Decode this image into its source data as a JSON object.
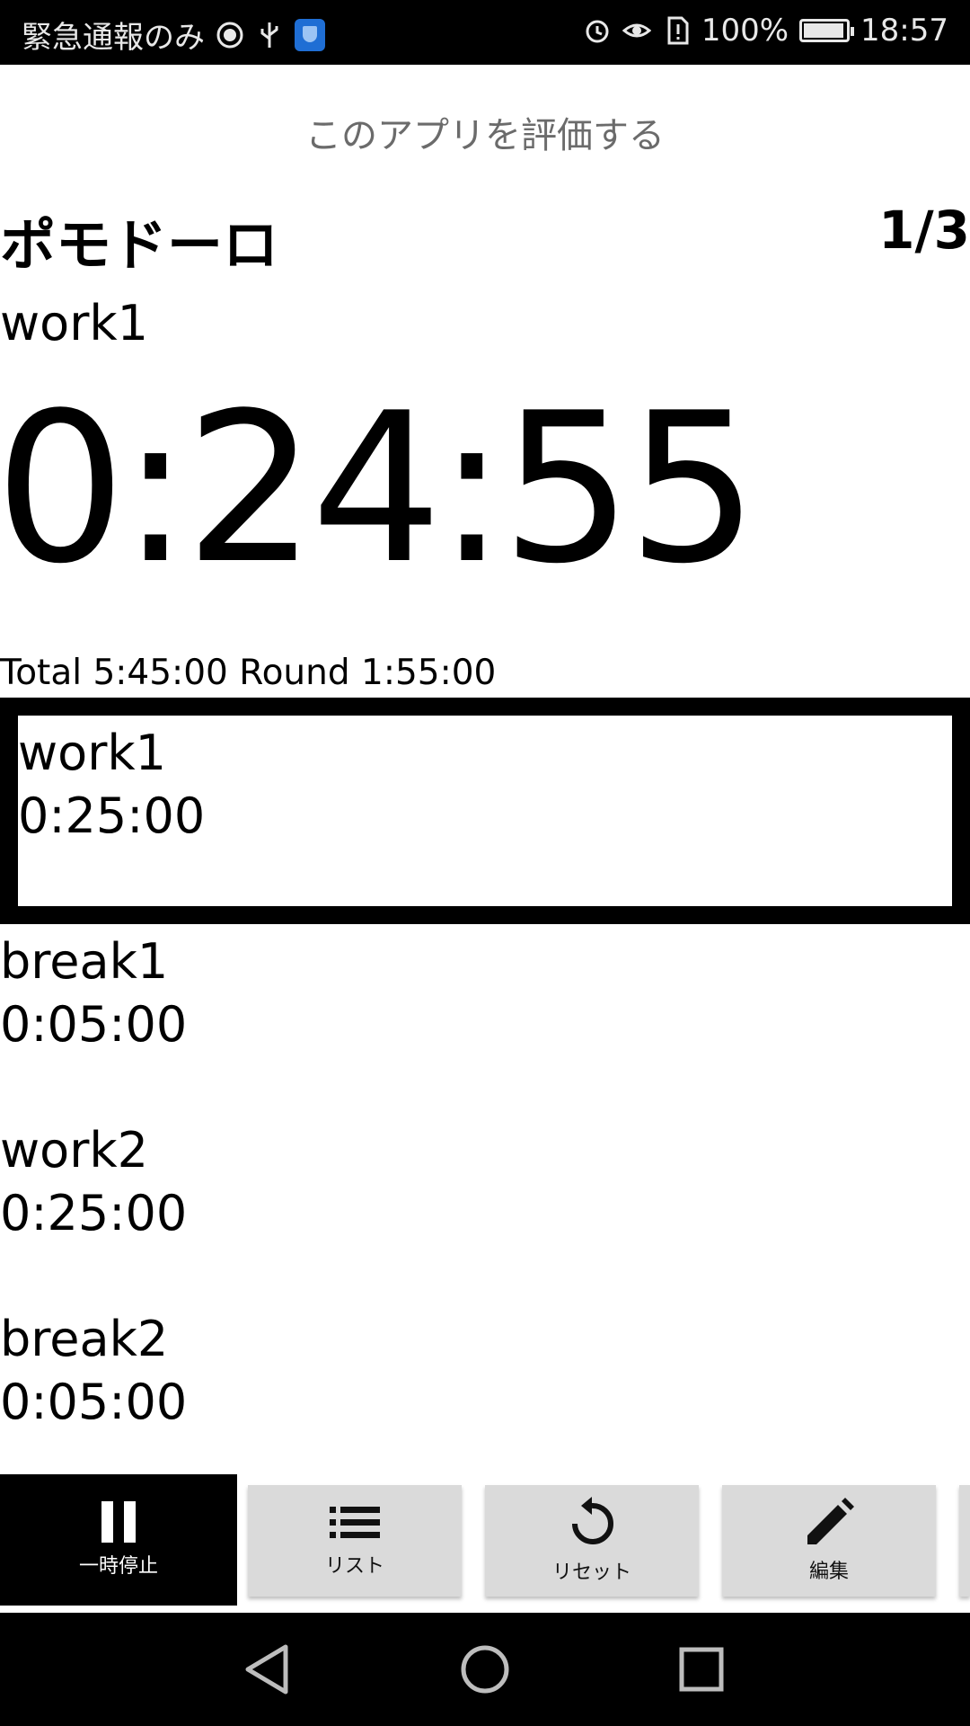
{
  "status_bar": {
    "carrier_text": "緊急通報のみ",
    "battery": "100%",
    "time": "18:57",
    "battery_level": 1.0,
    "icons": [
      "data-saver-icon",
      "usb-icon",
      "shield-icon",
      "alarm-icon",
      "eye-icon",
      "sim-alert-icon",
      "battery-charging-icon"
    ]
  },
  "rate_app": "このアプリを評価する",
  "header": {
    "title": "ポモドーロ",
    "counter": "1/3"
  },
  "current": {
    "name": "work1",
    "timer": "0:24:55",
    "totals": "Total 5:45:00   Round 1:55:00"
  },
  "steps": [
    {
      "name": "work1",
      "duration": "0:25:00",
      "active": true
    },
    {
      "name": "break1",
      "duration": "0:05:00",
      "active": false
    },
    {
      "name": "work2",
      "duration": "0:25:00",
      "active": false
    },
    {
      "name": "break2",
      "duration": "0:05:00",
      "active": false
    }
  ],
  "toolbar": {
    "pause_label": "一時停止",
    "list_label": "リスト",
    "reset_label": "リセット",
    "edit_label": "編集"
  },
  "colors": {
    "status_bar_bg": "#000000",
    "button_bg": "#dadada",
    "active_button_bg": "#000000",
    "rate_text": "#6b6b6b",
    "shield_icon": "#1f6ed4"
  }
}
